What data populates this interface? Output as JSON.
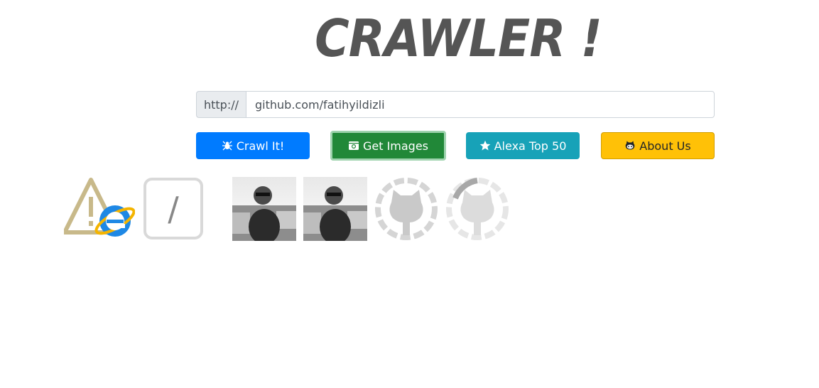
{
  "header": {
    "title": "CRAWLER !"
  },
  "search": {
    "prefix": "http://",
    "value": "github.com/fatihyildizli"
  },
  "buttons": {
    "crawl": "Crawl It!",
    "images": "Get Images",
    "alexa": "Alexa Top 50",
    "about": "About Us"
  },
  "icons": {
    "crawl": "spider-icon",
    "images": "camera-icon",
    "alexa": "star-icon",
    "about": "github-icon"
  },
  "results": {
    "slash_text": "/"
  },
  "colors": {
    "primary": "#007bff",
    "success": "#218838",
    "info": "#17a2b8",
    "warning": "#ffc107"
  }
}
